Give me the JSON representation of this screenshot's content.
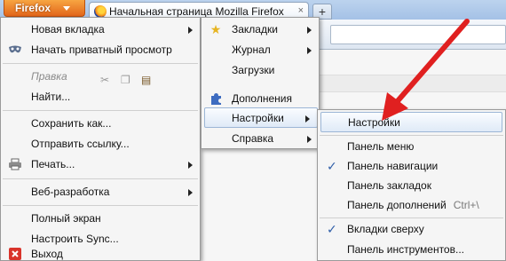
{
  "app_button": {
    "label": "Firefox"
  },
  "tab": {
    "title": "Начальная страница Mozilla Firefox",
    "close": "×"
  },
  "newtab": {
    "label": "+"
  },
  "main_menu": {
    "items": [
      {
        "label": "Новая вкладка",
        "submenu": true,
        "icon": ""
      },
      {
        "label": "Начать приватный просмотр",
        "icon": "mask-icon"
      },
      {
        "label": "Правка",
        "disabled": true,
        "icon": ""
      },
      {
        "label": "Найти...",
        "icon": ""
      },
      {
        "label": "Сохранить как...",
        "icon": ""
      },
      {
        "label": "Отправить ссылку...",
        "icon": ""
      },
      {
        "label": "Печать...",
        "submenu": true,
        "icon": "printer-icon"
      },
      {
        "label": "Веб-разработка",
        "submenu": true,
        "icon": ""
      },
      {
        "label": "Полный экран",
        "icon": ""
      },
      {
        "label": "Настроить Sync...",
        "icon": "sync-icon"
      },
      {
        "label": "Выход",
        "icon": "exit-icon"
      }
    ]
  },
  "side_menu": {
    "items": [
      {
        "label": "Закладки",
        "submenu": true,
        "icon": "star-icon"
      },
      {
        "label": "Журнал",
        "submenu": true,
        "icon": ""
      },
      {
        "label": "Загрузки",
        "icon": ""
      },
      {
        "label": "Дополнения",
        "icon": "puzzle-icon"
      },
      {
        "label": "Настройки",
        "submenu": true,
        "icon": "",
        "highlighted": true
      },
      {
        "label": "Справка",
        "submenu": true,
        "icon": ""
      }
    ]
  },
  "options_menu": {
    "items": [
      {
        "label": "Настройки",
        "highlighted": true
      },
      {
        "label": "Панель меню",
        "checked": false
      },
      {
        "label": "Панель навигации",
        "checked": true
      },
      {
        "label": "Панель закладок",
        "checked": false
      },
      {
        "label": "Панель дополнений",
        "checked": false,
        "accel": "Ctrl+\\"
      },
      {
        "label": "Вкладки сверху",
        "checked": true
      },
      {
        "label": "Панель инструментов...",
        "checked": false
      }
    ]
  },
  "colors": {
    "accent_orange": "#e9781f",
    "arrow_red": "#e02020",
    "check_blue": "#2f5ea8"
  }
}
